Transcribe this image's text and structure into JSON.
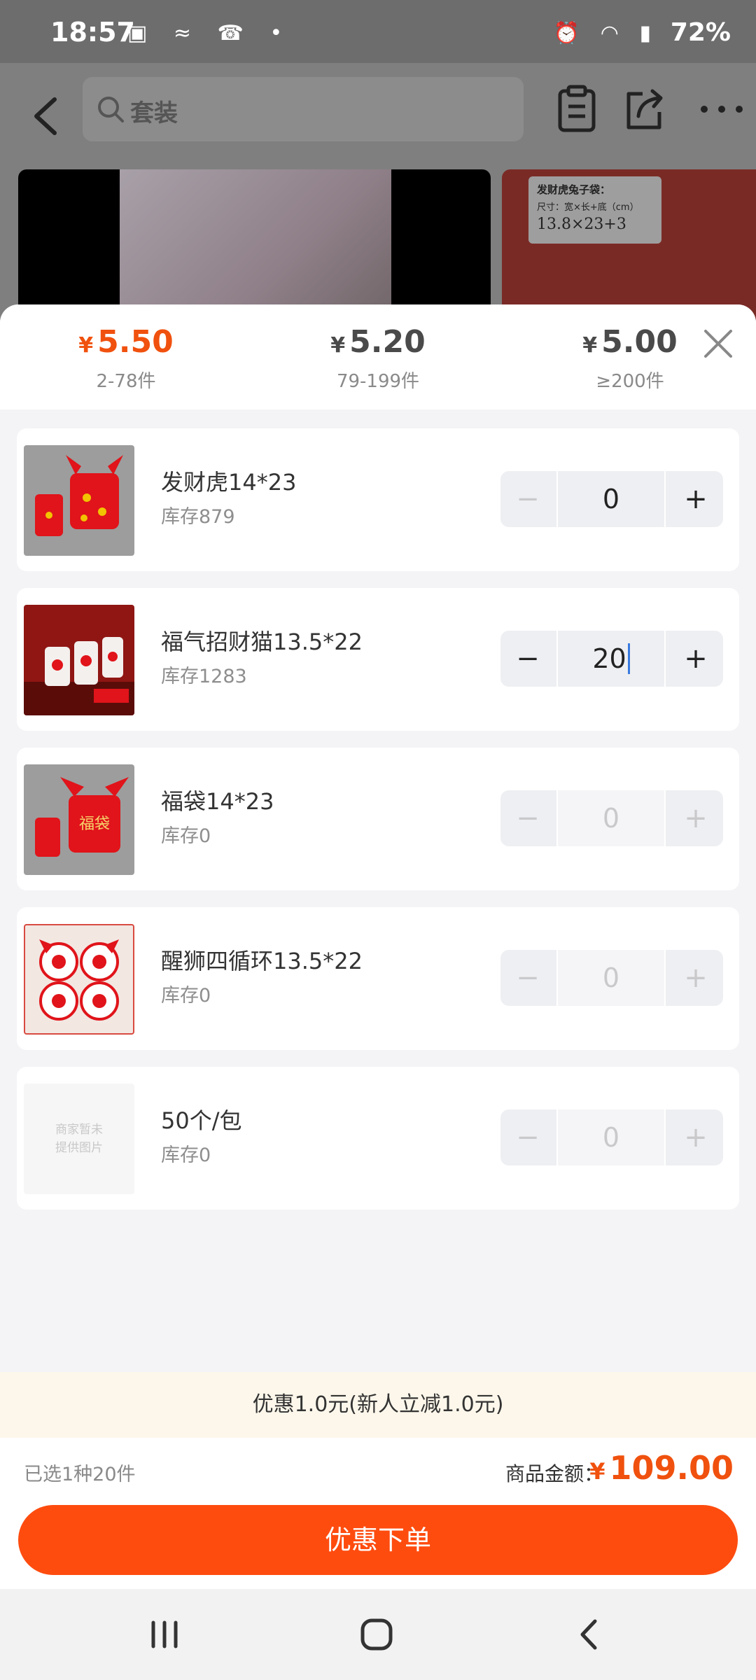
{
  "status_bar": {
    "time": "18:57",
    "battery": "72%"
  },
  "header": {
    "search_placeholder": "套装"
  },
  "product_preview": {
    "label_title": "发财虎兔子袋：",
    "label_size": "尺寸：宽×长+底（cm）",
    "label_dims": "13.8×23+3"
  },
  "price_tiers": [
    {
      "currency": "¥",
      "price": "5.50",
      "range": "2-78件"
    },
    {
      "currency": "¥",
      "price": "5.20",
      "range": "79-199件"
    },
    {
      "currency": "¥",
      "price": "5.00",
      "range": "≥200件"
    }
  ],
  "items": [
    {
      "name": "发财虎14*23",
      "stock": "库存879",
      "qty": "0",
      "minus": "−",
      "plus": "+"
    },
    {
      "name": "福气招财猫13.5*22",
      "stock": "库存1283",
      "qty": "20",
      "minus": "−",
      "plus": "+"
    },
    {
      "name": "福袋14*23",
      "stock": "库存0",
      "qty": "0",
      "minus": "−",
      "plus": "+",
      "thumb_text": "福袋"
    },
    {
      "name": "醒狮四循环13.5*22",
      "stock": "库存0",
      "qty": "0",
      "minus": "−",
      "plus": "+"
    },
    {
      "name": "50个/包",
      "stock": "库存0",
      "qty": "0",
      "minus": "−",
      "plus": "+",
      "thumb_text": "商家暂未提供图片"
    }
  ],
  "promo": {
    "text": "优惠1.0元(新人立减1.0元)"
  },
  "summary": {
    "selected": "已选1种20件",
    "amount_label": "商品金额：",
    "currency": "¥",
    "amount": "109.00"
  },
  "order_button": {
    "label": "优惠下单"
  },
  "colors": {
    "accent": "#f0510e",
    "button": "#fe4c0f",
    "promo_bg": "#fdf7eb"
  }
}
